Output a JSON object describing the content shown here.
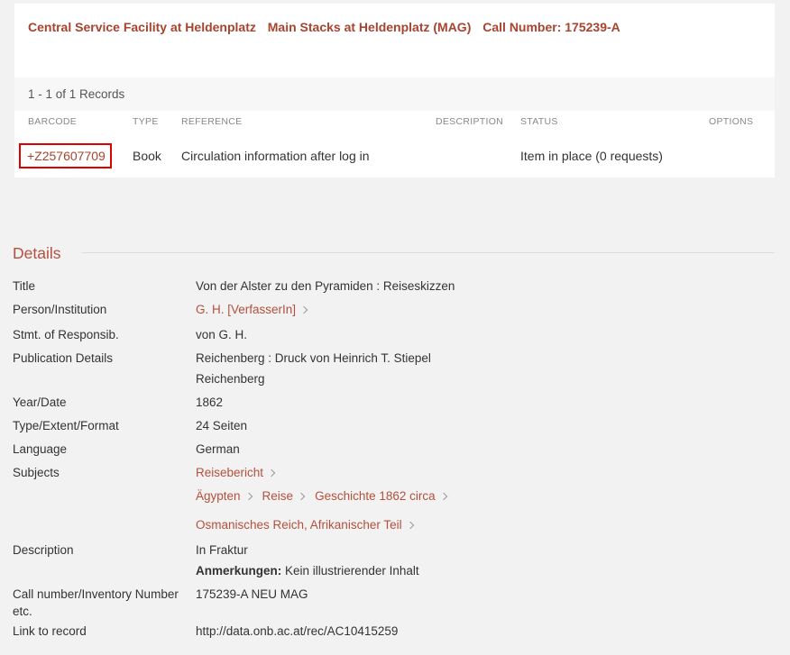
{
  "location": {
    "facility": "Central Service Facility at Heldenplatz",
    "collection": "Main Stacks at Heldenplatz (MAG)",
    "call_number": "Call Number: 175239-A"
  },
  "records_count": "1 - 1 of 1 Records",
  "items_table": {
    "headers": {
      "barcode": "BARCODE",
      "type": "TYPE",
      "reference": "REFERENCE",
      "description": "DESCRIPTION",
      "status": "STATUS",
      "options": "OPTIONS"
    },
    "rows": [
      {
        "barcode": "+Z257607709",
        "type": "Book",
        "reference": "Circulation information after log in",
        "description": "",
        "status": "Item in place (0 requests)",
        "options": ""
      }
    ]
  },
  "details": {
    "heading": "Details",
    "title_label": "Title",
    "title_value": "Von der Alster zu den Pyramiden : Reiseskizzen",
    "person_label": "Person/Institution",
    "person_value": "G. H. [VerfasserIn]",
    "responsibility_label": "Stmt. of Responsib.",
    "responsibility_value": "von G. H.",
    "publication_label": "Publication Details",
    "publication_line1": "Reichenberg : Druck von Heinrich T. Stiepel",
    "publication_line2": "Reichenberg",
    "year_label": "Year/Date",
    "year_value": "1862",
    "extent_label": "Type/Extent/Format",
    "extent_value": "24 Seiten",
    "language_label": "Language",
    "language_value": "German",
    "subjects_label": "Subjects",
    "subjects": {
      "s1": "Reisebericht",
      "s2a": "Ägypten",
      "s2b": "Reise",
      "s2c": "Geschichte 1862 circa",
      "s3": "Osmanisches Reich, Afrikanischer Teil"
    },
    "description_label": "Description",
    "description_line1": "In Fraktur",
    "description_note_label": "Anmerkungen:",
    "description_note_value": "Kein illustrierender Inhalt",
    "callnum_label_line1": "Call number/Inventory Number",
    "callnum_label_line2": "etc.",
    "callnum_value": "175239-A NEU MAG",
    "link_label": "Link to record",
    "link_value": "http://data.onb.ac.at/rec/AC10415259"
  },
  "colors": {
    "accent": "#a8432f",
    "highlight_box": "#e00000",
    "page_bg": "#f2f2f2"
  },
  "icons": [
    "chevron-right-icon"
  ]
}
